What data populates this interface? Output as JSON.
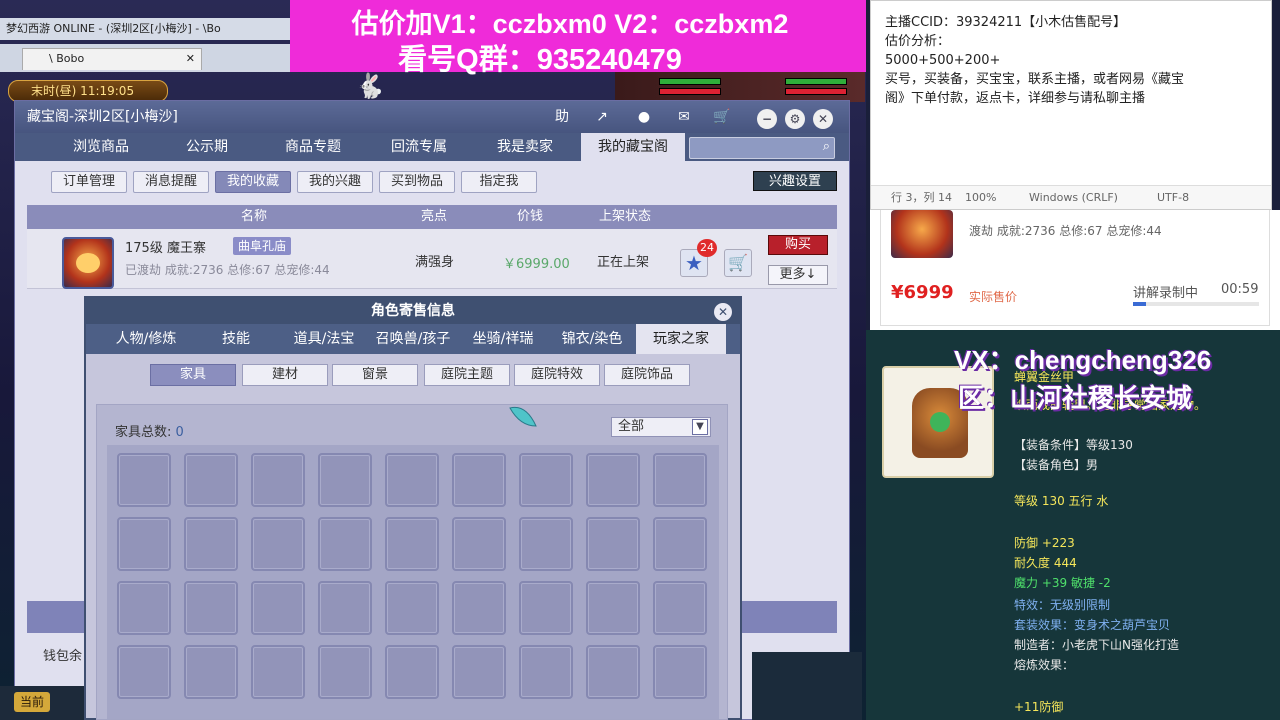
{
  "game": {
    "window_title": "梦幻西游 ONLINE - (深圳2区[小梅沙] - \\Bo",
    "browser_tab": "\\ Bobo",
    "clock": "末时(昼)  11:19:05",
    "current_label": "当前"
  },
  "banner": {
    "line1": "估价加V1：cczbxm0    V2：cczbxm2",
    "line2": "看号Q群：935240479"
  },
  "treasure": {
    "title": "藏宝阁-深圳2区[小梅沙]",
    "help_label": "助",
    "tabs": [
      "浏览商品",
      "公示期",
      "商品专题",
      "回流专属",
      "我是卖家",
      "我的藏宝阁"
    ],
    "active_tab": "我的藏宝阁",
    "sub_buttons": [
      "订单管理",
      "消息提醒",
      "我的收藏",
      "我的兴趣",
      "买到物品",
      "指定我"
    ],
    "active_sub": "我的收藏",
    "interest_settings": "兴趣设置",
    "columns": [
      "名称",
      "亮点",
      "价钱",
      "上架状态"
    ],
    "item": {
      "level_name": "175级  魔王寨",
      "server_tag": "曲阜孔庙",
      "detail": "已渡劫 成就:2736 总修:67 总宠修:44",
      "highlight": "满强身",
      "price": "￥6999.00",
      "status": "正在上架",
      "favorite_count": "24",
      "buy": "购买",
      "more": "更多↓"
    },
    "wallet": "钱包余"
  },
  "char_dialog": {
    "title": "角色寄售信息",
    "close": "✕",
    "tabs": [
      "人物/修炼",
      "技能",
      "道具/法宝",
      "召唤兽/孩子",
      "坐骑/祥瑞",
      "锦衣/染色",
      "玩家之家"
    ],
    "active_tab": "玩家之家",
    "filters": [
      "家具",
      "建材",
      "窗景",
      "庭院主题",
      "庭院特效",
      "庭院饰品"
    ],
    "active_filter": "家具",
    "furniture_total_label": "家具总数:",
    "furniture_total": "0",
    "select_value": "全部"
  },
  "notepad": {
    "line1": "主播CCID：39324211【小木估售配号】",
    "line2": "估价分析：",
    "line3": "5000+500+200+",
    "line4": "买号，买装备，买宝宝，联系主播，或者网易《藏宝",
    "line5": "阁》下单付款，返点卡，详细参与请私聊主播",
    "status_pos": "行 3，列 14",
    "status_zoom": "100%",
    "status_eol": "Windows (CRLF)",
    "status_enc": "UTF-8"
  },
  "product": {
    "desc": "渡劫 成就:2736 总修:67 总宠修:44",
    "price": "¥6999",
    "price_label": "实际售价",
    "status": "讲解录制中",
    "time": "00:59",
    "progress": 0.1
  },
  "equip": {
    "vx": "VX：chengcheng326",
    "zone": "区：山河社稷长安城",
    "name_partial": "蝉翼金丝甲",
    "lines": [
      {
        "text": "织而成的轻甲。绝非寻常仙家之物。",
        "style": "yellow"
      },
      {
        "text": "【装备条件】等级130",
        "style": "white"
      },
      {
        "text": "【装备角色】男",
        "style": "white"
      },
      {
        "text": "等级 130 五行 水",
        "style": "yellow"
      },
      {
        "text": "防御 +223",
        "style": "yellow"
      },
      {
        "text": "耐久度 444",
        "style": "yellow"
      },
      {
        "text": "魔力 +39 敏捷 -2",
        "style": "green"
      },
      {
        "text": "特效：无级别限制",
        "style": "blue"
      },
      {
        "text": "套装效果：变身术之葫芦宝贝",
        "style": "blue"
      },
      {
        "text": "制造者：小老虎下山N强化打造",
        "style": "white"
      },
      {
        "text": "熔炼效果：",
        "style": "white"
      },
      {
        "text": "+11防御",
        "style": "yellow"
      }
    ]
  },
  "colors": {
    "banner": "#ef2bd9",
    "accent": "#4a5a82",
    "price_red": "#e02020"
  },
  "icons": [
    "help-icon",
    "share-icon",
    "record-icon",
    "chat-icon",
    "cart-icon",
    "minimize-icon",
    "settings-icon",
    "close-icon",
    "search-icon",
    "star-icon"
  ]
}
